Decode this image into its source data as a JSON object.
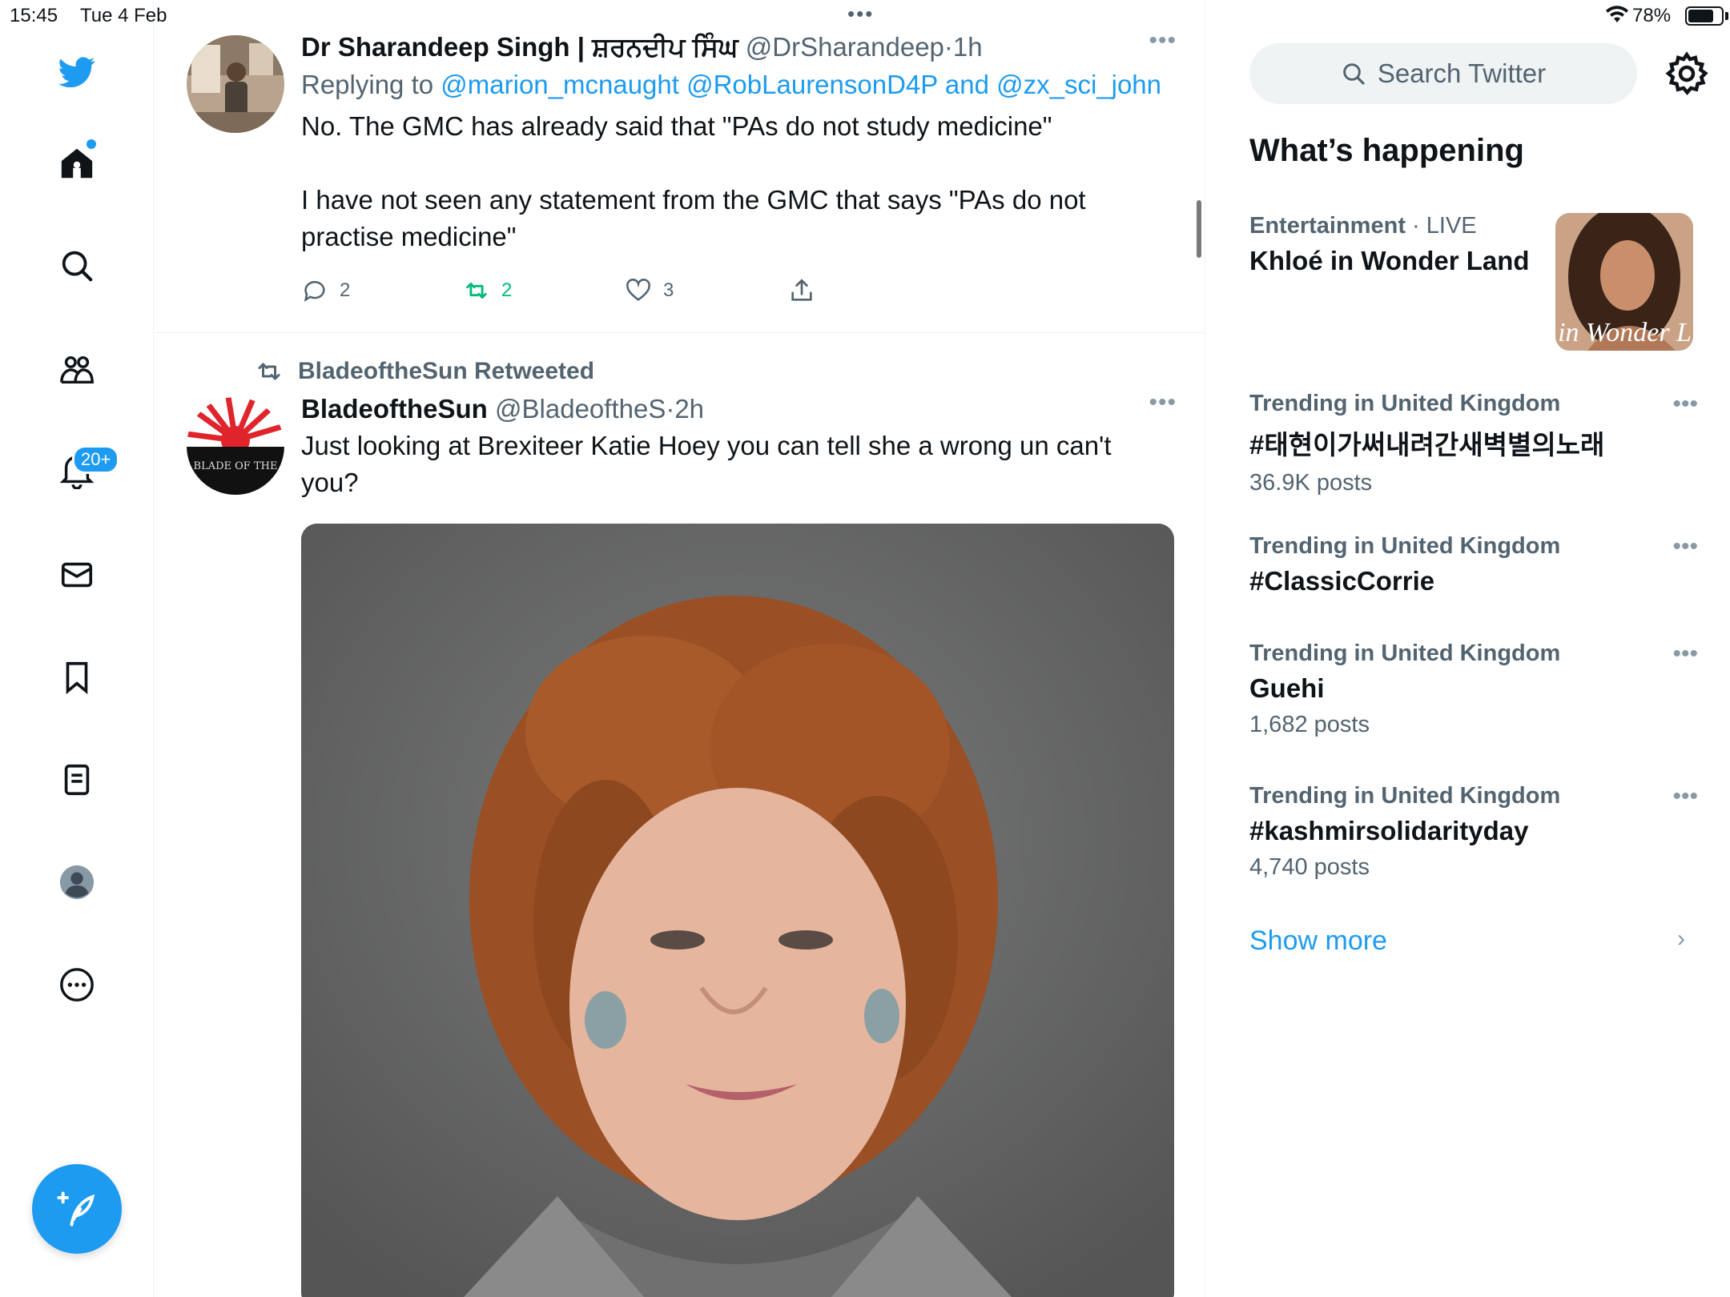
{
  "status_bar": {
    "time": "15:45",
    "date": "Tue 4 Feb",
    "battery": "78%",
    "battery_level": 0.78,
    "multitask_dots": "•••"
  },
  "nav": {
    "notifications_badge": "20+",
    "items": [
      "twitter-logo-icon",
      "home-icon",
      "search-icon",
      "communities-icon",
      "notifications-icon",
      "messages-icon",
      "bookmarks-icon",
      "lists-icon",
      "profile-icon",
      "more-icon"
    ]
  },
  "tweets": [
    {
      "name": "Dr Sharandeep Singh | ਸ਼ਰਨਦੀਪ ਸਿੰਘ",
      "handle": "@DrSharandeep",
      "sep": "·",
      "time": "1h",
      "replying_prefix": "Replying to",
      "mentions": "@marion_mcnaught @RobLaurensonD4P and @zx_sci_john",
      "text_1": "No. The GMC has already said that \"PAs do not study medicine\"",
      "text_2": "I have not seen any statement from the GMC that says \"PAs do not practise medicine\"",
      "replies": "2",
      "retweets": "2",
      "likes": "3",
      "more": "•••"
    },
    {
      "retweeted_by": "BladeoftheSun Retweeted",
      "name": "BladeoftheSun",
      "handle": "@BladeoftheS",
      "sep": "·",
      "time": "2h",
      "text": "Just looking at Brexiteer Katie Hoey you can tell she a wrong un can't you?",
      "avatar_text": "BLADE OF THE",
      "more": "•••"
    }
  ],
  "sidebar": {
    "search_placeholder": "Search Twitter",
    "section_title": "What’s happening",
    "featured": {
      "category": "Entertainment",
      "sep": "·",
      "live": "LIVE",
      "title": "Khloé in Wonder Land",
      "image_caption": "é in Wonder L"
    },
    "trends": [
      {
        "context": "Trending in United Kingdom",
        "title": "#태현이가써내려간새벽별의노래",
        "count": "36.9K posts"
      },
      {
        "context": "Trending in United Kingdom",
        "title": "#ClassicCorrie",
        "count": ""
      },
      {
        "context": "Trending in United Kingdom",
        "title": "Guehi",
        "count": "1,682 posts"
      },
      {
        "context": "Trending in United Kingdom",
        "title": "#kashmirsolidarityday",
        "count": "4,740 posts"
      }
    ],
    "show_more": "Show more",
    "more": "•••"
  },
  "colors": {
    "accent": "#1d9bf0",
    "secondary_text": "#536471",
    "retweet_green": "#00ba7c"
  }
}
